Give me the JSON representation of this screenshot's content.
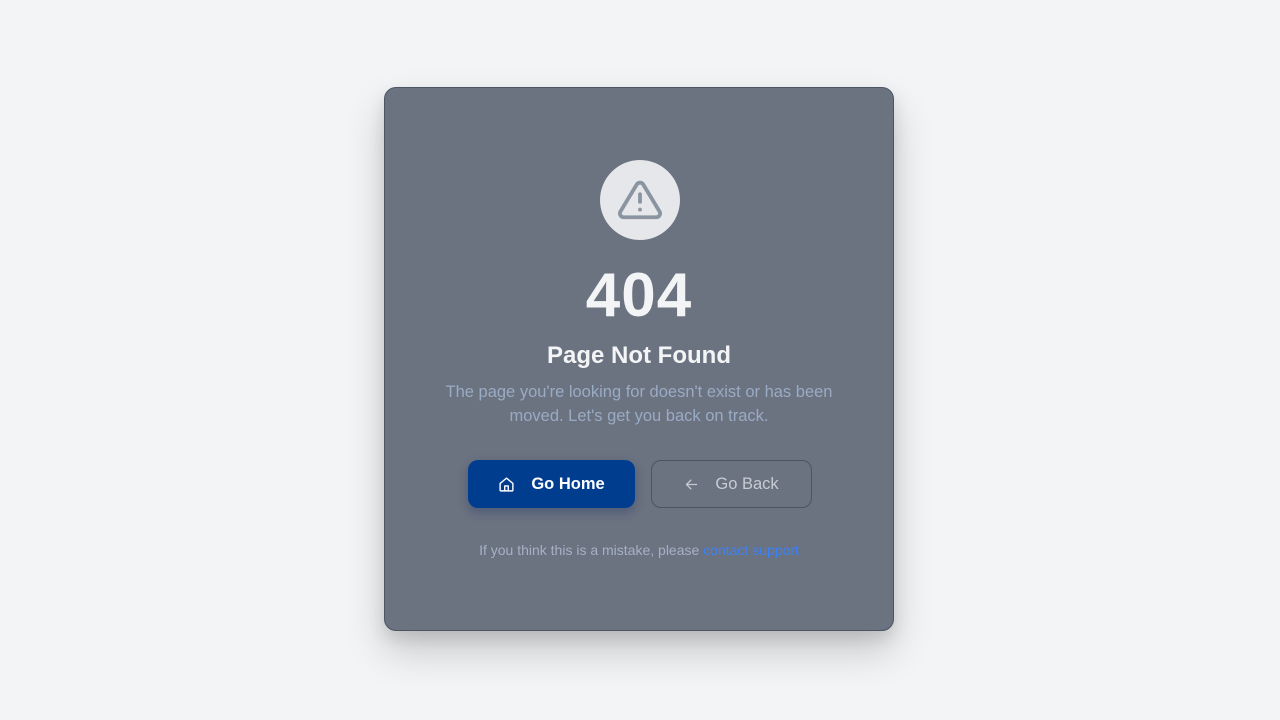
{
  "error": {
    "code": "404",
    "title": "Page Not Found",
    "message": "The page you're looking for doesn't exist or has been moved. Let's get you back on track."
  },
  "actions": {
    "home_label": "Go Home",
    "back_label": "Go Back"
  },
  "footer": {
    "text": "If you think this is a mistake, please",
    "link_label": "contact support"
  },
  "icons": {
    "status": "warning-triangle-icon",
    "home": "home-icon",
    "back": "arrow-left-icon"
  },
  "colors": {
    "page_background": "#f3f4f6",
    "card_background": "#6b7280",
    "primary_button": "#003d8f",
    "link": "#3b82f6"
  }
}
